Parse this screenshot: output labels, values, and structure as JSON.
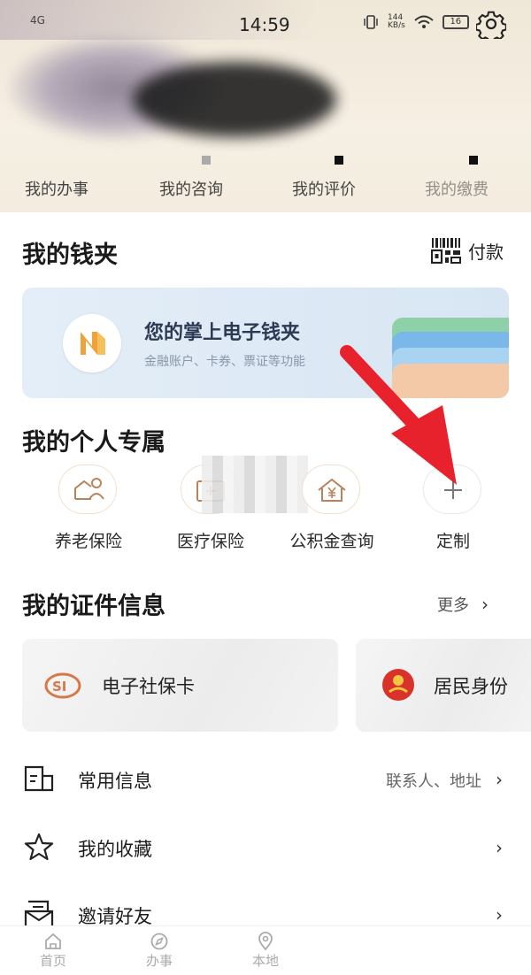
{
  "status_bar": {
    "network": "4G",
    "time": "14:59",
    "speed_top": "144",
    "speed_bottom": "KB/s",
    "battery": "16"
  },
  "header_tabs": [
    "我的办事",
    "我的咨询",
    "我的评价",
    "我的缴费"
  ],
  "wallet": {
    "title": "我的钱夹",
    "pay_label": "付款",
    "banner_title": "您的掌上电子钱夹",
    "banner_subtitle": "金融账户、卡券、票证等功能"
  },
  "personal": {
    "title": "我的个人专属",
    "items": [
      {
        "label": "养老保险",
        "icon": "house-person-icon"
      },
      {
        "label": "医疗保险",
        "icon": "medical-card-icon"
      },
      {
        "label": "公积金查询",
        "icon": "house-yuan-icon"
      },
      {
        "label": "定制",
        "icon": "plus-icon"
      }
    ]
  },
  "certificates": {
    "title": "我的证件信息",
    "more_label": "更多",
    "cards": [
      {
        "label": "电子社保卡",
        "icon": "social-security-logo-icon"
      },
      {
        "label": "居民身份",
        "icon": "national-emblem-icon"
      }
    ]
  },
  "menu": [
    {
      "label": "常用信息",
      "right": "联系人、地址",
      "icon": "info-card-icon"
    },
    {
      "label": "我的收藏",
      "right": "",
      "icon": "star-icon"
    },
    {
      "label": "邀请好友",
      "right": "",
      "icon": "invite-mail-icon"
    }
  ],
  "bottom_nav": [
    {
      "label": "首页",
      "icon": "home-icon"
    },
    {
      "label": "办事",
      "icon": "compass-icon"
    },
    {
      "label": "本地",
      "icon": "location-icon"
    }
  ],
  "colors": {
    "accent": "#f0a23a",
    "arrow": "#e8222c",
    "banner": "#dde9f5"
  }
}
